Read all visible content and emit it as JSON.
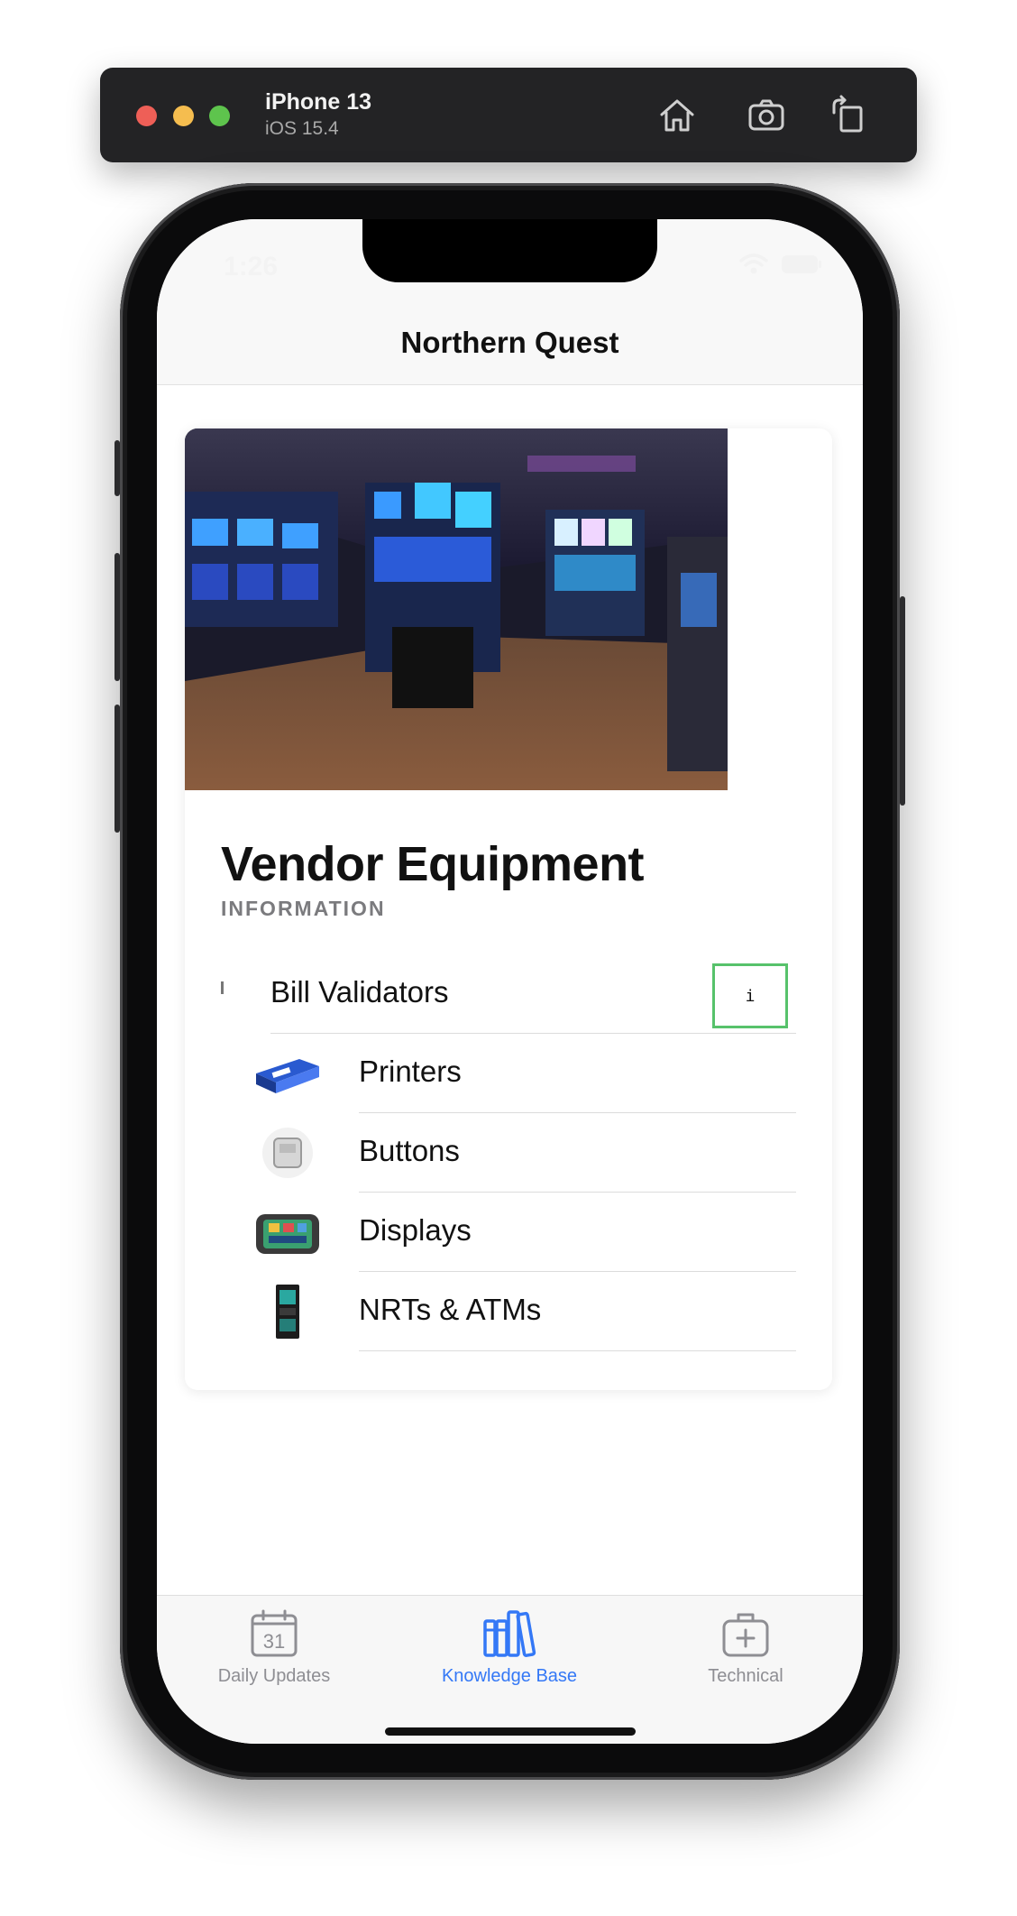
{
  "simulator": {
    "device_name": "iPhone 13",
    "os_version": "iOS 15.4",
    "toolbar_icons": [
      "home-icon",
      "screenshot-icon",
      "rotate-icon"
    ]
  },
  "status_bar": {
    "time": "1:26"
  },
  "nav": {
    "title": "Northern Quest"
  },
  "card": {
    "title": "Vendor Equipment",
    "subtitle": "INFORMATION",
    "items": [
      {
        "label": "Bill Validators",
        "thumb": "bill-validator-icon",
        "info_label": "i"
      },
      {
        "label": "Printers",
        "thumb": "printer-icon"
      },
      {
        "label": "Buttons",
        "thumb": "button-icon"
      },
      {
        "label": "Displays",
        "thumb": "display-icon"
      },
      {
        "label": "NRTs & ATMs",
        "thumb": "atm-icon"
      }
    ]
  },
  "tabs": [
    {
      "label": "Daily Updates",
      "icon": "calendar-icon",
      "calendar_day": "31",
      "active": false
    },
    {
      "label": "Knowledge Base",
      "icon": "books-icon",
      "active": true
    },
    {
      "label": "Technical",
      "icon": "medical-bag-icon",
      "active": false
    }
  ],
  "colors": {
    "accent": "#3478f6",
    "inactive": "#8e8e93",
    "highlight_border": "#57c26b"
  }
}
